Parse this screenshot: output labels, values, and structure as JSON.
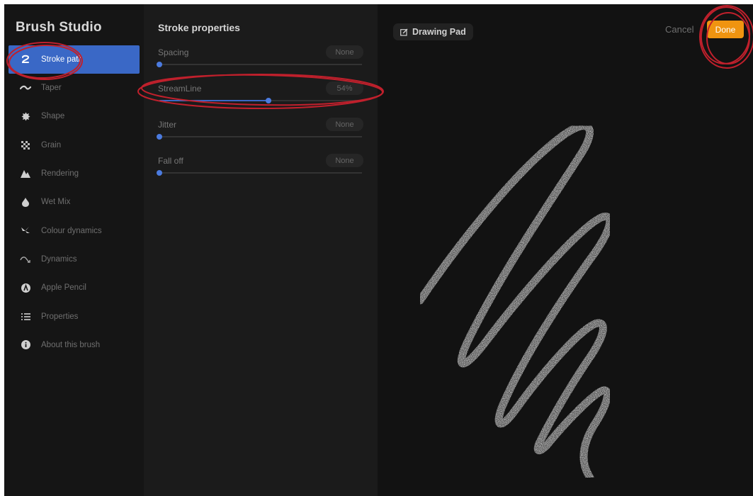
{
  "app": {
    "title": "Brush Studio"
  },
  "sidebar": {
    "items": [
      {
        "label": "Stroke path",
        "icon": "stroke-path-icon",
        "active": true
      },
      {
        "label": "Taper",
        "icon": "taper-icon",
        "active": false
      },
      {
        "label": "Shape",
        "icon": "shape-icon",
        "active": false
      },
      {
        "label": "Grain",
        "icon": "grain-icon",
        "active": false
      },
      {
        "label": "Rendering",
        "icon": "rendering-icon",
        "active": false
      },
      {
        "label": "Wet Mix",
        "icon": "wet-mix-icon",
        "active": false
      },
      {
        "label": "Colour dynamics",
        "icon": "colour-dynamics-icon",
        "active": false
      },
      {
        "label": "Dynamics",
        "icon": "dynamics-icon",
        "active": false
      },
      {
        "label": "Apple Pencil",
        "icon": "apple-pencil-icon",
        "active": false
      },
      {
        "label": "Properties",
        "icon": "properties-icon",
        "active": false
      },
      {
        "label": "About this brush",
        "icon": "info-icon",
        "active": false
      }
    ]
  },
  "panel": {
    "title": "Stroke properties",
    "properties": [
      {
        "label": "Spacing",
        "value": "None",
        "level": 0.0
      },
      {
        "label": "StreamLine",
        "value": "54%",
        "level": 0.54
      },
      {
        "label": "Jitter",
        "value": "None",
        "level": 0.0
      },
      {
        "label": "Fall off",
        "value": "None",
        "level": 0.0
      }
    ]
  },
  "pad": {
    "button_label": "Drawing Pad",
    "cancel_label": "Cancel",
    "done_label": "Done"
  },
  "colors": {
    "accent": "#3a68c6",
    "done": "#f09410",
    "annotation": "#c0202c"
  }
}
